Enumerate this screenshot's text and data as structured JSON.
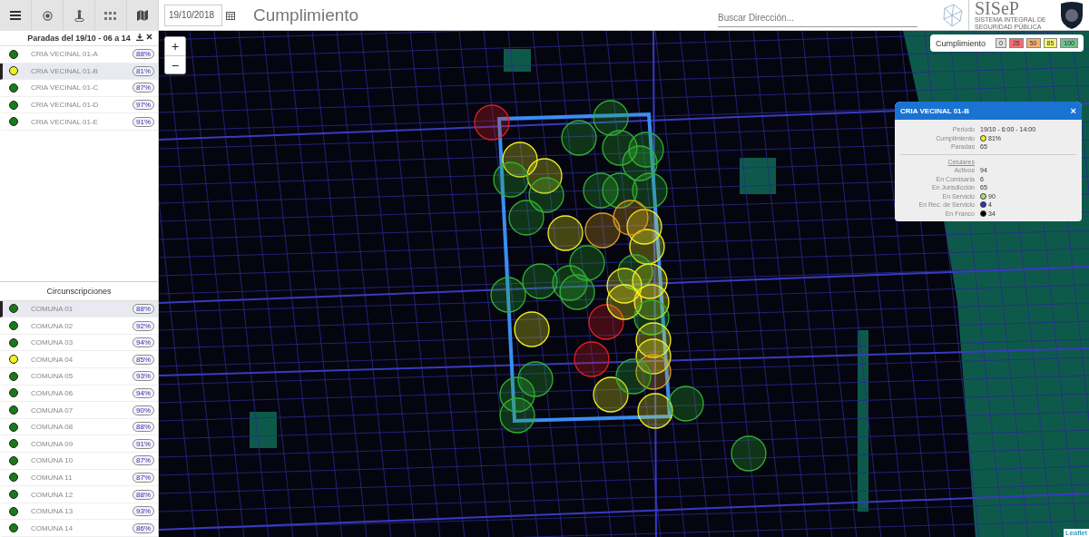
{
  "toolbar": {
    "buttons": [
      {
        "kind": "menu",
        "selected": false
      },
      {
        "kind": "target",
        "selected": false
      },
      {
        "kind": "pin",
        "selected": false
      },
      {
        "kind": "grid",
        "selected": false
      },
      {
        "kind": "map",
        "selected": false
      }
    ]
  },
  "date_field": {
    "value": "19/10/2018"
  },
  "title": "Cumplimiento",
  "search": {
    "placeholder": "Buscar Dirección..."
  },
  "logo": {
    "name": "SISeP",
    "subtitle": "SISTEMA INTEGRAL DE SEGURIDAD PÚBLICA"
  },
  "paradas": {
    "title": "Paradas del 19/10 - 06 a 14",
    "items": [
      {
        "name": "CRIA VECINAL 01-A",
        "percent": "88%",
        "color": "#1a7a1a",
        "selected": false
      },
      {
        "name": "CRIA VECINAL 01-B",
        "percent": "81%",
        "color": "#f2f21c",
        "selected": true
      },
      {
        "name": "CRIA VECINAL 01-C",
        "percent": "87%",
        "color": "#1a7a1a",
        "selected": false
      },
      {
        "name": "CRIA VECINAL 01-D",
        "percent": "97%",
        "color": "#1a7a1a",
        "selected": false
      },
      {
        "name": "CRIA VECINAL 01-E",
        "percent": "91%",
        "color": "#1a7a1a",
        "selected": false
      }
    ]
  },
  "circunscripciones": {
    "title": "Circunscripciones",
    "items": [
      {
        "name": "COMUNA 01",
        "percent": "88%",
        "color": "#1a7a1a",
        "selected": true
      },
      {
        "name": "COMUNA 02",
        "percent": "92%",
        "color": "#1a7a1a",
        "selected": false
      },
      {
        "name": "COMUNA 03",
        "percent": "94%",
        "color": "#1a7a1a",
        "selected": false
      },
      {
        "name": "COMUNA 04",
        "percent": "85%",
        "color": "#f2f21c",
        "selected": false
      },
      {
        "name": "COMUNA 05",
        "percent": "93%",
        "color": "#1a7a1a",
        "selected": false
      },
      {
        "name": "COMUNA 06",
        "percent": "94%",
        "color": "#1a7a1a",
        "selected": false
      },
      {
        "name": "COMUNA 07",
        "percent": "90%",
        "color": "#1a7a1a",
        "selected": false
      },
      {
        "name": "COMUNA 08",
        "percent": "88%",
        "color": "#1a7a1a",
        "selected": false
      },
      {
        "name": "COMUNA 09",
        "percent": "91%",
        "color": "#1a7a1a",
        "selected": false
      },
      {
        "name": "COMUNA 10",
        "percent": "87%",
        "color": "#1a7a1a",
        "selected": false
      },
      {
        "name": "COMUNA 11",
        "percent": "87%",
        "color": "#1a7a1a",
        "selected": false
      },
      {
        "name": "COMUNA 12",
        "percent": "88%",
        "color": "#1a7a1a",
        "selected": false
      },
      {
        "name": "COMUNA 13",
        "percent": "93%",
        "color": "#1a7a1a",
        "selected": false
      },
      {
        "name": "COMUNA 14",
        "percent": "86%",
        "color": "#1a7a1a",
        "selected": false
      }
    ]
  },
  "zoom": {
    "in": "+",
    "out": "−"
  },
  "legend": {
    "title": "Cumplimiento",
    "steps": [
      {
        "label": "0",
        "color": "#dddddd"
      },
      {
        "label": "25",
        "color": "#f07070"
      },
      {
        "label": "50",
        "color": "#f5b070"
      },
      {
        "label": "85",
        "color": "#f5f570"
      },
      {
        "label": "100",
        "color": "#70c090"
      }
    ]
  },
  "popup": {
    "title": "CRIA VECINAL 01-B",
    "close": "×",
    "rows": [
      {
        "kind": "text",
        "label": "Periodo",
        "value": "19/10 - 6:00 - 14:00"
      },
      {
        "kind": "dot",
        "label": "Cumplimiento",
        "value": "81%",
        "color": "#f2f21c"
      },
      {
        "kind": "text",
        "label": "Paradas",
        "value": "65"
      },
      {
        "kind": "divider"
      },
      {
        "kind": "heading",
        "label": "Celulares"
      },
      {
        "kind": "text",
        "label": "Activos",
        "value": "94"
      },
      {
        "kind": "text",
        "label": "En Comisaría",
        "value": "6"
      },
      {
        "kind": "text",
        "label": "En Jurisdicción",
        "value": "65"
      },
      {
        "kind": "dot",
        "label": "En Servicio",
        "value": "90",
        "color": "#a0e080"
      },
      {
        "kind": "dot",
        "label": "En Rec. de Servicio",
        "value": "4",
        "color": "#3030c0"
      },
      {
        "kind": "dot",
        "label": "En Franco",
        "value": "34",
        "color": "#000000"
      }
    ]
  },
  "attribution": "Leaflet"
}
